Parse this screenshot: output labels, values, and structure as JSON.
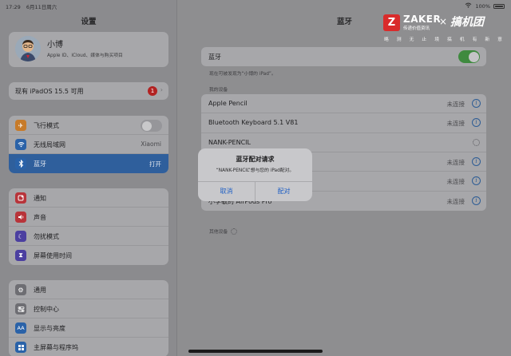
{
  "status_bar": {
    "time": "17:29",
    "date": "6月11日周六",
    "battery": "100%"
  },
  "sidebar": {
    "title": "设置",
    "profile": {
      "name": "小博",
      "subtitle": "Apple ID、iCloud、媒体与购买项目"
    },
    "update": {
      "label": "现有 iPadOS 15.5 可用",
      "badge": "1"
    },
    "group1": [
      {
        "label": "飞行模式",
        "icon": "airplane-icon",
        "color": "#c77b2a"
      },
      {
        "label": "无线局域网",
        "value": "Xiaomi",
        "icon": "wifi-icon",
        "color": "#2a62a8"
      },
      {
        "label": "蓝牙",
        "value": "打开",
        "icon": "bluetooth-icon",
        "color": "#2a62a8"
      }
    ],
    "group2": [
      {
        "label": "通知",
        "icon": "bell-icon",
        "color": "#b8343a"
      },
      {
        "label": "声音",
        "icon": "speaker-icon",
        "color": "#b8343a"
      },
      {
        "label": "勿扰模式",
        "icon": "moon-icon",
        "color": "#4b3fa0"
      },
      {
        "label": "屏幕使用时间",
        "icon": "hourglass-icon",
        "color": "#4b3fa0"
      }
    ],
    "group3": [
      {
        "label": "通用",
        "icon": "gear-icon",
        "color": "#6e6e73"
      },
      {
        "label": "控制中心",
        "icon": "switches-icon",
        "color": "#6e6e73"
      },
      {
        "label": "显示与亮度",
        "icon": "aa-icon",
        "color": "#2a62a8"
      },
      {
        "label": "主屏幕与程序坞",
        "icon": "grid-icon",
        "color": "#2a62a8"
      }
    ]
  },
  "main": {
    "title": "蓝牙",
    "bluetooth_label": "蓝牙",
    "discoverable_text": "现在可被发现为“小博的 iPad”。",
    "my_devices_header": "我的设备",
    "devices": [
      {
        "name": "Apple Pencil",
        "status": "未连接"
      },
      {
        "name": "Bluetooth Keyboard 5.1 V81",
        "status": "未连接"
      },
      {
        "name": "NANK-PENCIL",
        "status": ""
      },
      {
        "name": "",
        "status": "未连接"
      },
      {
        "name": "",
        "status": "未连接"
      },
      {
        "name": "小李敏的 AirPods Pro",
        "status": "未连接"
      }
    ],
    "other_devices_header": "其他设备"
  },
  "alert": {
    "title": "蓝牙配对请求",
    "message": "“NANK-PENCIL”想与您的 iPad配对。",
    "cancel": "取消",
    "confirm": "配对"
  },
  "watermark": {
    "logo_letter": "Z",
    "brand": "ZAKER",
    "brand_sub": "传递价值资讯",
    "times": "×",
    "partner": "搞机团",
    "tagline": [
      "略",
      "测",
      "无",
      "止",
      "境",
      "搞",
      "机",
      "有",
      "新",
      "意"
    ]
  }
}
